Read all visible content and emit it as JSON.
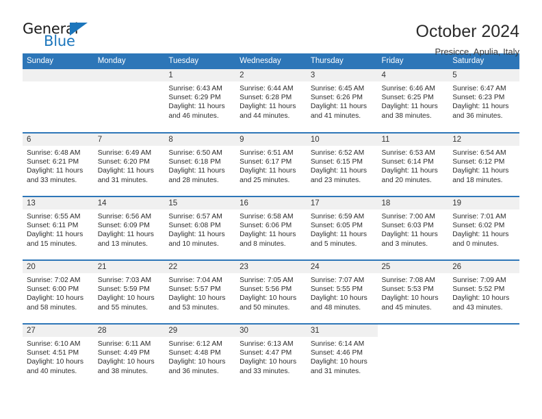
{
  "brand": {
    "name_top": "General",
    "name_bottom": "Blue",
    "triangle_color": "#1c76bc"
  },
  "header": {
    "title": "October 2024",
    "location": "Presicce, Apulia, Italy"
  },
  "theme": {
    "header_blue": "#2d76b8",
    "daynum_gray": "#f0f0f0",
    "text": "#2b2b2b"
  },
  "weekdays": [
    "Sunday",
    "Monday",
    "Tuesday",
    "Wednesday",
    "Thursday",
    "Friday",
    "Saturday"
  ],
  "labels": {
    "sunrise_prefix": "Sunrise:",
    "sunset_prefix": "Sunset:",
    "daylight_prefix": "Daylight:"
  },
  "weeks": [
    [
      {
        "day": "",
        "sunrise": "",
        "sunset": "",
        "daylight": "",
        "empty": true
      },
      {
        "day": "",
        "sunrise": "",
        "sunset": "",
        "daylight": "",
        "empty": true
      },
      {
        "day": "1",
        "sunrise": "Sunrise: 6:43 AM",
        "sunset": "Sunset: 6:29 PM",
        "daylight": "Daylight: 11 hours and 46 minutes."
      },
      {
        "day": "2",
        "sunrise": "Sunrise: 6:44 AM",
        "sunset": "Sunset: 6:28 PM",
        "daylight": "Daylight: 11 hours and 44 minutes."
      },
      {
        "day": "3",
        "sunrise": "Sunrise: 6:45 AM",
        "sunset": "Sunset: 6:26 PM",
        "daylight": "Daylight: 11 hours and 41 minutes."
      },
      {
        "day": "4",
        "sunrise": "Sunrise: 6:46 AM",
        "sunset": "Sunset: 6:25 PM",
        "daylight": "Daylight: 11 hours and 38 minutes."
      },
      {
        "day": "5",
        "sunrise": "Sunrise: 6:47 AM",
        "sunset": "Sunset: 6:23 PM",
        "daylight": "Daylight: 11 hours and 36 minutes."
      }
    ],
    [
      {
        "day": "6",
        "sunrise": "Sunrise: 6:48 AM",
        "sunset": "Sunset: 6:21 PM",
        "daylight": "Daylight: 11 hours and 33 minutes."
      },
      {
        "day": "7",
        "sunrise": "Sunrise: 6:49 AM",
        "sunset": "Sunset: 6:20 PM",
        "daylight": "Daylight: 11 hours and 31 minutes."
      },
      {
        "day": "8",
        "sunrise": "Sunrise: 6:50 AM",
        "sunset": "Sunset: 6:18 PM",
        "daylight": "Daylight: 11 hours and 28 minutes."
      },
      {
        "day": "9",
        "sunrise": "Sunrise: 6:51 AM",
        "sunset": "Sunset: 6:17 PM",
        "daylight": "Daylight: 11 hours and 25 minutes."
      },
      {
        "day": "10",
        "sunrise": "Sunrise: 6:52 AM",
        "sunset": "Sunset: 6:15 PM",
        "daylight": "Daylight: 11 hours and 23 minutes."
      },
      {
        "day": "11",
        "sunrise": "Sunrise: 6:53 AM",
        "sunset": "Sunset: 6:14 PM",
        "daylight": "Daylight: 11 hours and 20 minutes."
      },
      {
        "day": "12",
        "sunrise": "Sunrise: 6:54 AM",
        "sunset": "Sunset: 6:12 PM",
        "daylight": "Daylight: 11 hours and 18 minutes."
      }
    ],
    [
      {
        "day": "13",
        "sunrise": "Sunrise: 6:55 AM",
        "sunset": "Sunset: 6:11 PM",
        "daylight": "Daylight: 11 hours and 15 minutes."
      },
      {
        "day": "14",
        "sunrise": "Sunrise: 6:56 AM",
        "sunset": "Sunset: 6:09 PM",
        "daylight": "Daylight: 11 hours and 13 minutes."
      },
      {
        "day": "15",
        "sunrise": "Sunrise: 6:57 AM",
        "sunset": "Sunset: 6:08 PM",
        "daylight": "Daylight: 11 hours and 10 minutes."
      },
      {
        "day": "16",
        "sunrise": "Sunrise: 6:58 AM",
        "sunset": "Sunset: 6:06 PM",
        "daylight": "Daylight: 11 hours and 8 minutes."
      },
      {
        "day": "17",
        "sunrise": "Sunrise: 6:59 AM",
        "sunset": "Sunset: 6:05 PM",
        "daylight": "Daylight: 11 hours and 5 minutes."
      },
      {
        "day": "18",
        "sunrise": "Sunrise: 7:00 AM",
        "sunset": "Sunset: 6:03 PM",
        "daylight": "Daylight: 11 hours and 3 minutes."
      },
      {
        "day": "19",
        "sunrise": "Sunrise: 7:01 AM",
        "sunset": "Sunset: 6:02 PM",
        "daylight": "Daylight: 11 hours and 0 minutes."
      }
    ],
    [
      {
        "day": "20",
        "sunrise": "Sunrise: 7:02 AM",
        "sunset": "Sunset: 6:00 PM",
        "daylight": "Daylight: 10 hours and 58 minutes."
      },
      {
        "day": "21",
        "sunrise": "Sunrise: 7:03 AM",
        "sunset": "Sunset: 5:59 PM",
        "daylight": "Daylight: 10 hours and 55 minutes."
      },
      {
        "day": "22",
        "sunrise": "Sunrise: 7:04 AM",
        "sunset": "Sunset: 5:57 PM",
        "daylight": "Daylight: 10 hours and 53 minutes."
      },
      {
        "day": "23",
        "sunrise": "Sunrise: 7:05 AM",
        "sunset": "Sunset: 5:56 PM",
        "daylight": "Daylight: 10 hours and 50 minutes."
      },
      {
        "day": "24",
        "sunrise": "Sunrise: 7:07 AM",
        "sunset": "Sunset: 5:55 PM",
        "daylight": "Daylight: 10 hours and 48 minutes."
      },
      {
        "day": "25",
        "sunrise": "Sunrise: 7:08 AM",
        "sunset": "Sunset: 5:53 PM",
        "daylight": "Daylight: 10 hours and 45 minutes."
      },
      {
        "day": "26",
        "sunrise": "Sunrise: 7:09 AM",
        "sunset": "Sunset: 5:52 PM",
        "daylight": "Daylight: 10 hours and 43 minutes."
      }
    ],
    [
      {
        "day": "27",
        "sunrise": "Sunrise: 6:10 AM",
        "sunset": "Sunset: 4:51 PM",
        "daylight": "Daylight: 10 hours and 40 minutes."
      },
      {
        "day": "28",
        "sunrise": "Sunrise: 6:11 AM",
        "sunset": "Sunset: 4:49 PM",
        "daylight": "Daylight: 10 hours and 38 minutes."
      },
      {
        "day": "29",
        "sunrise": "Sunrise: 6:12 AM",
        "sunset": "Sunset: 4:48 PM",
        "daylight": "Daylight: 10 hours and 36 minutes."
      },
      {
        "day": "30",
        "sunrise": "Sunrise: 6:13 AM",
        "sunset": "Sunset: 4:47 PM",
        "daylight": "Daylight: 10 hours and 33 minutes."
      },
      {
        "day": "31",
        "sunrise": "Sunrise: 6:14 AM",
        "sunset": "Sunset: 4:46 PM",
        "daylight": "Daylight: 10 hours and 31 minutes."
      },
      {
        "day": "",
        "sunrise": "",
        "sunset": "",
        "daylight": "",
        "empty": true,
        "nofill": true
      },
      {
        "day": "",
        "sunrise": "",
        "sunset": "",
        "daylight": "",
        "empty": true,
        "nofill": true
      }
    ]
  ]
}
